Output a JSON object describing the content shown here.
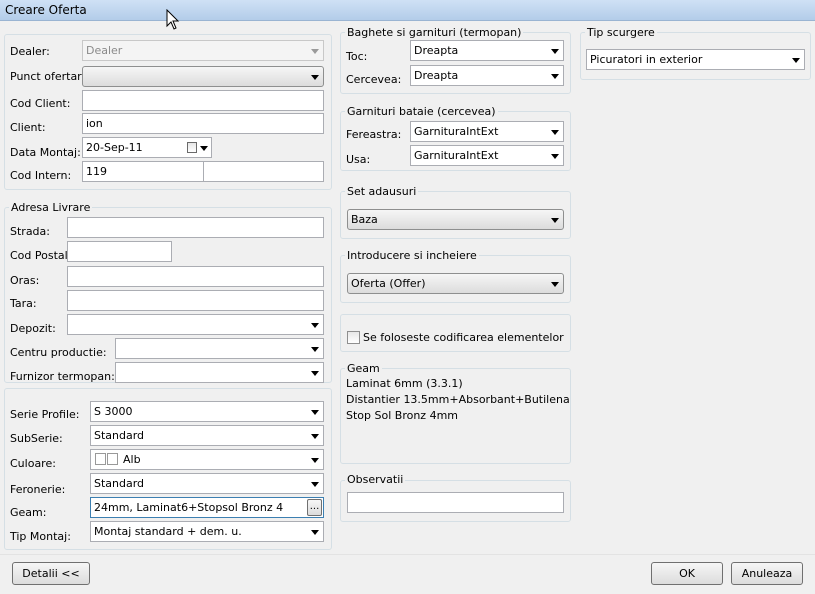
{
  "window": {
    "title": "Creare Oferta"
  },
  "dealer": {
    "dealer_label": "Dealer:",
    "dealer_value": "Dealer",
    "punct_label": "Punct ofertare:",
    "punct_value": "",
    "cod_client_label": "Cod Client:",
    "cod_client_value": "",
    "client_label": "Client:",
    "client_value": "ion",
    "data_montaj_label": "Data Montaj:",
    "data_montaj_value": "20-Sep-11",
    "cod_intern_label": "Cod Intern:",
    "cod_intern_value": "119",
    "cod_intern_value2": ""
  },
  "adresa": {
    "title": "Adresa Livrare",
    "strada_label": "Strada:",
    "strada_value": "",
    "cod_postal_label": "Cod Postal:",
    "cod_postal_value": "",
    "oras_label": "Oras:",
    "oras_value": "",
    "tara_label": "Tara:",
    "tara_value": "",
    "depozit_label": "Depozit:",
    "depozit_value": "",
    "centru_label": "Centru productie:",
    "centru_value": "",
    "furnizor_label": "Furnizor termopan:",
    "furnizor_value": ""
  },
  "profile": {
    "serie_label": "Serie Profile:",
    "serie_value": "S 3000",
    "subserie_label": "SubSerie:",
    "subserie_value": "Standard",
    "culoare_label": "Culoare:",
    "culoare_value": "Alb",
    "feronerie_label": "Feronerie:",
    "feronerie_value": "Standard",
    "geam_label": "Geam:",
    "geam_value": "24mm, Laminat6+Stopsol Bronz 4",
    "geam_button": "...",
    "tip_montaj_label": "Tip Montaj:",
    "tip_montaj_value": "Montaj standard + dem. u."
  },
  "baghete": {
    "title": "Baghete si garnituri (termopan)",
    "toc_label": "Toc:",
    "toc_value": "Dreapta",
    "cercevea_label": "Cercevea:",
    "cercevea_value": "Dreapta"
  },
  "garnituri": {
    "title": "Garnituri bataie (cercevea)",
    "fereastra_label": "Fereastra:",
    "fereastra_value": "GarnituraIntExt",
    "usa_label": "Usa:",
    "usa_value": "GarnituraIntExt"
  },
  "set_adausuri": {
    "title": "Set adausuri",
    "value": "Baza"
  },
  "introducere": {
    "title": "Introducere si incheiere",
    "value": "Oferta (Offer)"
  },
  "codificare": {
    "label": "Se foloseste codificarea elementelor",
    "checked": false
  },
  "geam_info": {
    "title": "Geam",
    "lines": [
      "Laminat 6mm (3.3.1)",
      "Distantier 13.5mm+Absorbant+Butilena",
      "Stop Sol Bronz 4mm"
    ]
  },
  "observatii": {
    "title": "Observatii",
    "value": ""
  },
  "tip_scurgere": {
    "title": "Tip scurgere",
    "value": "Picuratori in exterior"
  },
  "buttons": {
    "detalii": "Detalii <<",
    "ok": "OK",
    "anuleaza": "Anuleaza"
  },
  "icons": {
    "dropdown": "chevron-down-icon",
    "calendar": "calendar-icon",
    "color_swatch": "color-swatch-icon",
    "cursor": "mouse-cursor-icon"
  }
}
